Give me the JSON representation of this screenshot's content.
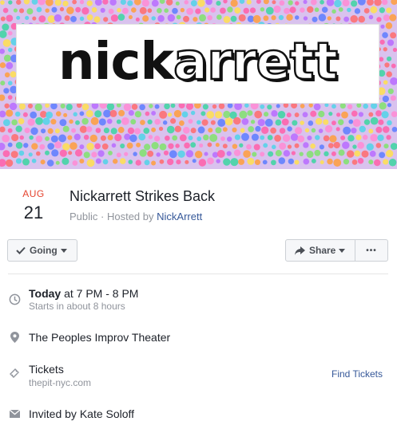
{
  "cover": {
    "logo_text_solid": "nick",
    "logo_text_outline": "arrett"
  },
  "event": {
    "month": "AUG",
    "day": "21",
    "title": "Nickarrett Strikes Back",
    "privacy": "Public",
    "separator": " · Hosted by ",
    "host": "NickArrett"
  },
  "actions": {
    "going_label": "Going",
    "share_label": "Share",
    "more_label": "•••"
  },
  "details": {
    "time_bold": "Today",
    "time_rest": " at 7 PM - 8 PM",
    "time_sub": "Starts in about 8 hours",
    "location": "The Peoples Improv Theater",
    "tickets_label": "Tickets",
    "tickets_site": "thepit-nyc.com",
    "find_tickets": "Find Tickets",
    "invited_by": "Invited by Kate Soloff"
  },
  "icons": {
    "time": "clock-icon",
    "location": "map-pin-icon",
    "tickets": "ticket-icon",
    "invite": "envelope-icon",
    "going": "checkmark-icon",
    "share": "share-arrow-icon"
  },
  "colors": {
    "date_month": "#e5432e",
    "link": "#365899",
    "muted": "#90949c"
  }
}
